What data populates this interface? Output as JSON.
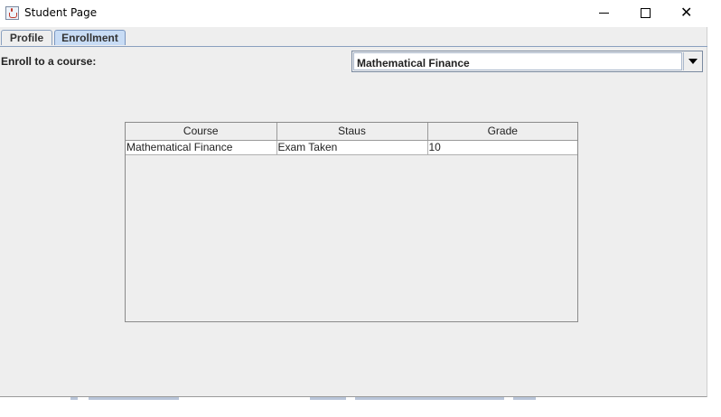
{
  "window": {
    "title": "Student Page",
    "controls": {
      "minimize": "—",
      "close": "✕"
    }
  },
  "tabs": [
    {
      "label": "Profile",
      "selected": false
    },
    {
      "label": "Enrollment",
      "selected": true
    }
  ],
  "enroll": {
    "label": "Enroll to a course:",
    "selected_course": "Mathematical Finance"
  },
  "table": {
    "columns": [
      "Course",
      "Staus",
      "Grade"
    ],
    "rows": [
      [
        "Mathematical Finance",
        "Exam Taken",
        "10"
      ]
    ]
  },
  "colors": {
    "window_bg": "#eeeeee",
    "selected_tab": "#c8dcf5",
    "border": "#8aa0bf"
  },
  "icons": {
    "app": "java-cup-icon",
    "dropdown": "chevron-down-icon"
  }
}
